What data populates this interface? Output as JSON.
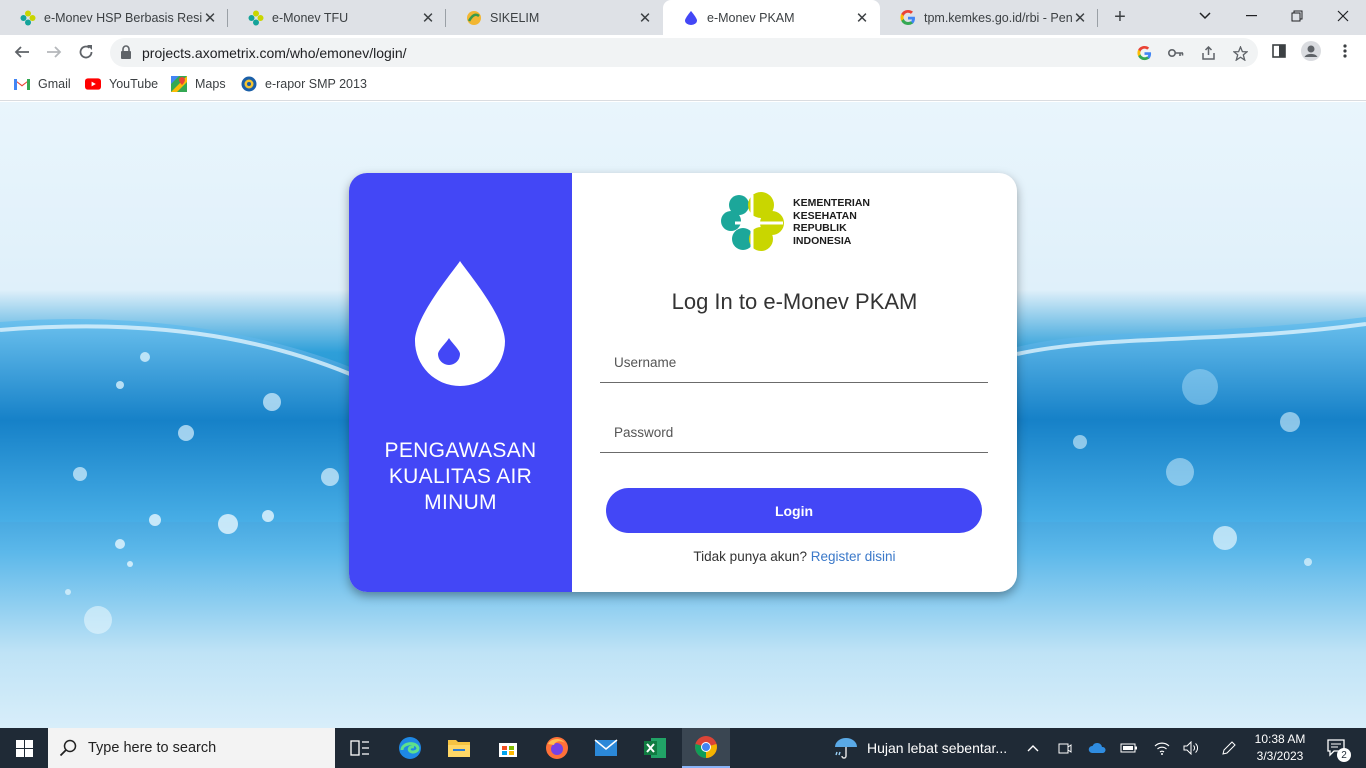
{
  "browser": {
    "tabs": [
      {
        "title": "e-Monev HSP Berbasis Resiko",
        "icon": "kemenkes-icon",
        "active": false
      },
      {
        "title": "e-Monev TFU",
        "icon": "kemenkes-icon",
        "active": false
      },
      {
        "title": "SIKELIM",
        "icon": "sikelim-icon",
        "active": false
      },
      {
        "title": "e-Monev PKAM",
        "icon": "water-drop-icon",
        "active": true
      },
      {
        "title": "tpm.kemkes.go.id/rbi - Penelit",
        "icon": "google-icon",
        "active": false
      }
    ],
    "url": "projects.axometrix.com/who/emonev/login/",
    "bookmarks": [
      {
        "label": "Gmail",
        "icon": "gmail-icon"
      },
      {
        "label": "YouTube",
        "icon": "youtube-icon"
      },
      {
        "label": "Maps",
        "icon": "maps-icon"
      },
      {
        "label": "e-rapor SMP 2013",
        "icon": "tut-wuri-icon"
      }
    ]
  },
  "login": {
    "tagline_1": "PENGAWASAN",
    "tagline_2": "KUALITAS AIR",
    "tagline_3": "MINUM",
    "logo_line_1": "KEMENTERIAN",
    "logo_line_2": "KESEHATAN",
    "logo_line_3": "REPUBLIK",
    "logo_line_4": "INDONESIA",
    "heading": "Log In to e-Monev PKAM",
    "username_placeholder": "Username",
    "username_value": "",
    "password_placeholder": "Password",
    "password_value": "",
    "login_label": "Login",
    "register_prompt": "Tidak punya akun?",
    "register_link": "Register disini"
  },
  "taskbar": {
    "search_placeholder": "Type here to search",
    "weather": "Hujan lebat sebentar...",
    "time": "10:38 AM",
    "date": "3/3/2023",
    "notification_count": "2"
  },
  "colors": {
    "primary": "#4347f6",
    "link": "#3a78c9"
  }
}
